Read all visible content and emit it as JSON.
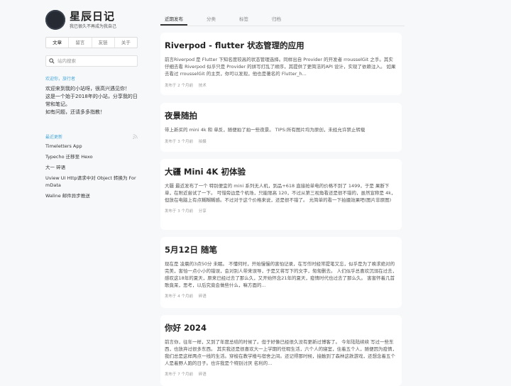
{
  "site": {
    "title": "星辰日记",
    "subtitle": "我已很久不再成为我自己"
  },
  "nav": [
    {
      "label": "文章",
      "active": true
    },
    {
      "label": "留言",
      "active": false
    },
    {
      "label": "友链",
      "active": false
    },
    {
      "label": "关于",
      "active": false
    }
  ],
  "search": {
    "placeholder": "站内搜索"
  },
  "welcome": {
    "heading": "欢迎你，旅行者",
    "lines": [
      "欢迎来到我的小站呀，很高兴遇见你！",
      "这是一个始于2018年的小站，分享我的日常和笔记。",
      "如有问题，还请多多指教！"
    ]
  },
  "recent": {
    "heading": "最近更新",
    "items": [
      "Timeletters App",
      "Typecho 迁移至 Hexo",
      "大一 碎语",
      "Uview UI Http请求中对 Object 转换为 FormData",
      "Waline 邮件异步推送"
    ]
  },
  "tabs": [
    {
      "label": "近期发布",
      "active": true
    },
    {
      "label": "分类",
      "active": false
    },
    {
      "label": "标签",
      "active": false
    },
    {
      "label": "归档",
      "active": false
    }
  ],
  "posts": [
    {
      "title": "Riverpod - flutter 状态管理的应用",
      "excerpt": "前言Riverpod 是 Flutter 下知名度较高的状态管理选择。同样出自 Provider 的开发者 rrousselGit 之手。其实仔细去看 Riverpod 似乎只是 Provider 的拼写打乱了顺序，其提供了更简洁的API 设计，实现了依赖注入。 如果去看过 rrousselGit 的主页，你可以发现，他也是著名的 Flutter_h...",
      "date": "发布于 2 个月前",
      "category": "技术"
    },
    {
      "title": "夜景随拍",
      "excerpt": "带上新买的 mini 4k 和 单反，随便拍了拍一些夜景。 TIPS:所有图片均为原创，未经允许禁止转载",
      "date": "发布于 3 个月前",
      "category": "拍摄"
    },
    {
      "title": "大疆 Mini 4K 初体验",
      "excerpt": "大疆 最近发布了一个 特别便宜的 mini 系列无人机，到品+618 直接抢单电的价格不到了 1499，于是 果断下单，在附近尝试了一下。 可惜旁边是个机场，只能限高 120，不过从第三视角看还是很不错的，虽然宣称是 4k，但放在电脑上有点糊糊糊感。不过对于这个价格来说，还是很不错了。 光简单的看一下拍摄效果吧(图片非原图)",
      "date": "发布于 3 个月前",
      "category": "分享"
    },
    {
      "title": "5月12日 随笔",
      "excerpt": "现在是 凌晨的3点50分 未眠。 不懂何时，开始慢慢的害怕记录，在写作时经常提笔又忘，似乎是为了唤求绝对的完美，害怕一点小小的错误，会对别人带来误导，于是又将写下的文字，匆匆删去。 人们似乎总喜欢沉溺在过去，感叹这18年的夏天，原来已经过去了那么久，又开始怀念21年的夏天，疫情时代也过去了那么久。 害害怀着几首歌竟呆，思考，以后究竟会做些什么，嘛方面的...",
      "date": "发布于 4 个月前",
      "category": "碎语"
    },
    {
      "title": "你好 2024",
      "excerpt": "前言你，往年一样，又到了年度总结的时候了。但于好像已经很久没有更新过博客了。 今年陆陆续续 写过一些东西，也放弃过很多东西。 其实我还是很喜欢大一上学期的任暇生活，六个人的寝室，住着五个人，随便因为疫情，我们总是这样两点一线的生活。穿梭在教学楼与宿舍之间。还记得那时候，接触到了森林这款游戏，还想念着五个人是着野人跑的日子。也许我是个特别讨厌 名利的...",
      "date": "发布于 7 个月前",
      "category": "碎语"
    }
  ]
}
